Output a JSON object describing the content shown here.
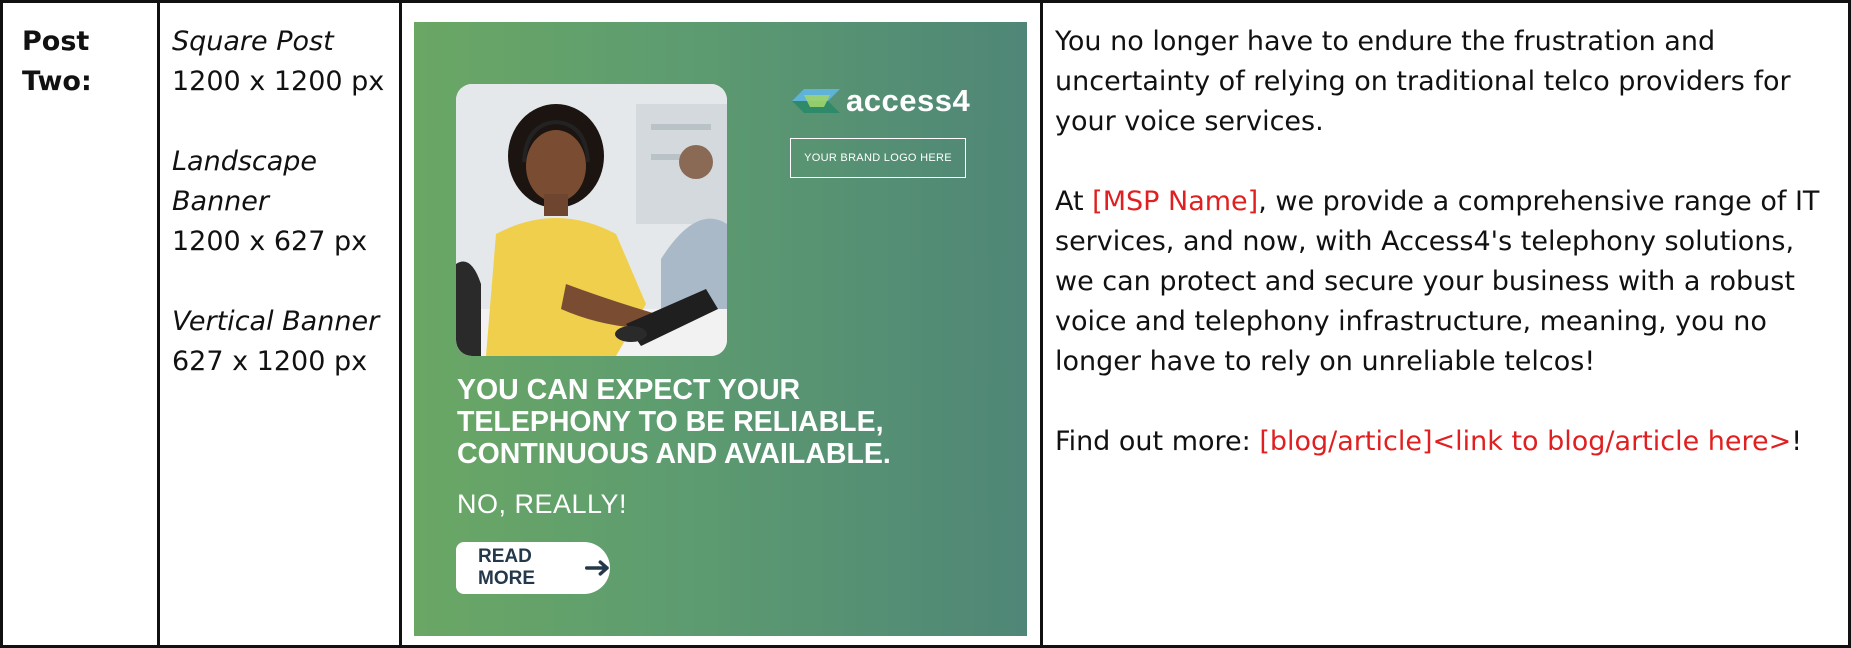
{
  "row": {
    "label_line1": "Post",
    "label_line2": "Two:",
    "sizes": [
      {
        "name_lines": [
          "Square Post"
        ],
        "dims": "1200 x 1200 px"
      },
      {
        "name_lines": [
          "Landscape",
          "Banner"
        ],
        "dims": "1200 x 627 px"
      },
      {
        "name_lines": [
          "Vertical Banner"
        ],
        "dims": "627 x 1200 px"
      }
    ]
  },
  "banner": {
    "logo_text": "access4",
    "brand_placeholder": "YOUR BRAND LOGO HERE",
    "headline_lines": [
      "YOU CAN EXPECT YOUR",
      "TELEPHONY TO BE RELIABLE,",
      "CONTINUOUS AND AVAILABLE."
    ],
    "subhead": "NO, REALLY!",
    "cta_label": "READ MORE",
    "colors": {
      "gradient_start": "#6aa765",
      "gradient_end": "#4f8677",
      "cta_text": "#23384a"
    }
  },
  "copy": {
    "para1": "You no longer have to endure the frustration and uncertainty of relying on traditional telco providers for your voice services.",
    "para2_before": "At ",
    "para2_placeholder": "[MSP Name]",
    "para2_after": ", we provide a comprehensive range of IT services, and now, with Access4's telephony solutions, we can protect and secure your business with a robust voice and telephony infrastructure, meaning, you no longer have to rely on unreliable telcos!",
    "para3_before": "Find out more: ",
    "para3_placeholder": "[blog/article]<link to blog/article here>",
    "para3_after": "!",
    "placeholder_color": "#e02020"
  }
}
